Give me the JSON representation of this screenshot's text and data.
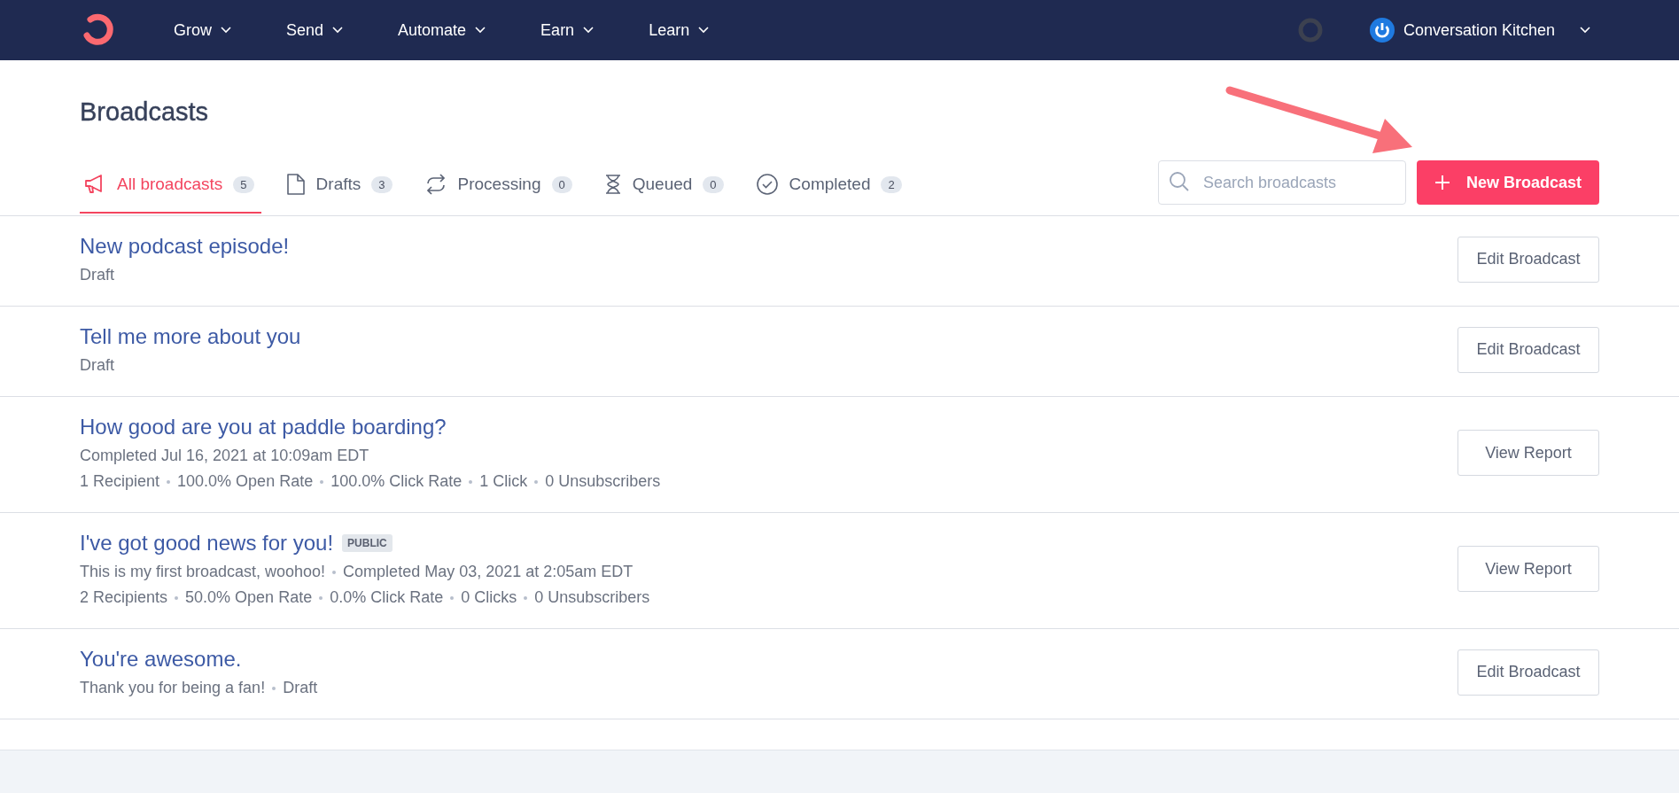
{
  "nav": {
    "items": [
      "Grow",
      "Send",
      "Automate",
      "Earn",
      "Learn"
    ],
    "account": "Conversation Kitchen"
  },
  "page": {
    "title": "Broadcasts"
  },
  "tabs": [
    {
      "label": "All broadcasts",
      "count": "5",
      "selected": true
    },
    {
      "label": "Drafts",
      "count": "3",
      "selected": false
    },
    {
      "label": "Processing",
      "count": "0",
      "selected": false
    },
    {
      "label": "Queued",
      "count": "0",
      "selected": false
    },
    {
      "label": "Completed",
      "count": "2",
      "selected": false
    }
  ],
  "search": {
    "placeholder": "Search broadcasts"
  },
  "new_button": {
    "label": "New Broadcast"
  },
  "broadcasts": [
    {
      "title": "New podcast episode!",
      "lines": [
        [
          "Draft"
        ]
      ],
      "action": "Edit Broadcast"
    },
    {
      "title": "Tell me more about you",
      "lines": [
        [
          "Draft"
        ]
      ],
      "action": "Edit Broadcast"
    },
    {
      "title": "How good are you at paddle boarding?",
      "lines": [
        [
          "Completed Jul 16, 2021 at 10:09am EDT"
        ],
        [
          "1 Recipient",
          "100.0% Open Rate",
          "100.0% Click Rate",
          "1 Click",
          "0 Unsubscribers"
        ]
      ],
      "action": "View Report"
    },
    {
      "title": "I've got good news for you!",
      "badge": "PUBLIC",
      "lines": [
        [
          "This is my first broadcast, woohoo!",
          "Completed May 03, 2021 at 2:05am EDT"
        ],
        [
          "2 Recipients",
          "50.0% Open Rate",
          "0.0% Click Rate",
          "0 Clicks",
          "0 Unsubscribers"
        ]
      ],
      "action": "View Report"
    },
    {
      "title": "You're awesome.",
      "lines": [
        [
          "Thank you for being a fan!",
          "Draft"
        ]
      ],
      "action": "Edit Broadcast"
    }
  ]
}
